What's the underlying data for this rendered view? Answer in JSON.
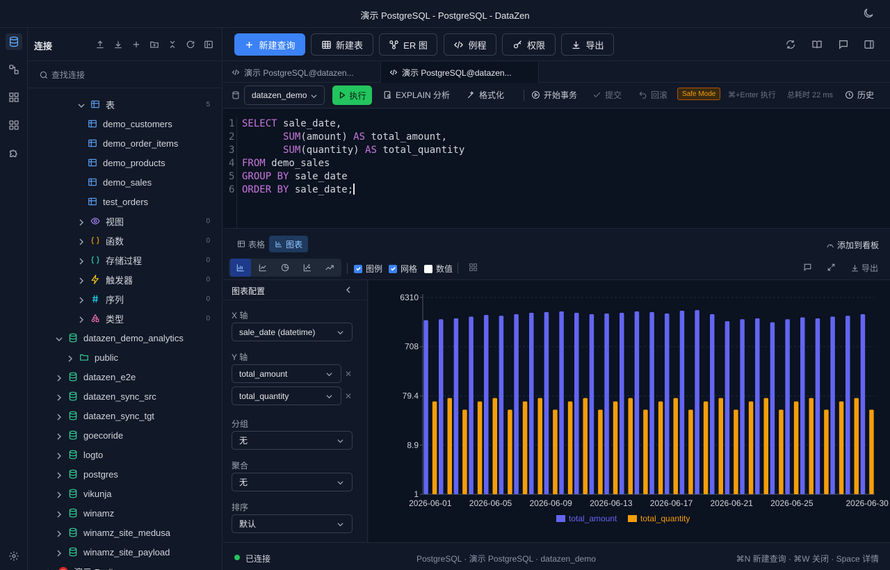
{
  "window": {
    "title": "演示 PostgreSQL - PostgreSQL - DataZen"
  },
  "sidebar": {
    "title": "连接",
    "search_placeholder": "查找连接",
    "tree": [
      {
        "label": "表",
        "count": "5",
        "indent": 1,
        "icon": "table-icon",
        "chev": "down"
      },
      {
        "label": "demo_customers",
        "indent": 2,
        "icon": "table-icon"
      },
      {
        "label": "demo_order_items",
        "indent": 2,
        "icon": "table-icon"
      },
      {
        "label": "demo_products",
        "indent": 2,
        "icon": "table-icon"
      },
      {
        "label": "demo_sales",
        "indent": 2,
        "icon": "table-icon"
      },
      {
        "label": "test_orders",
        "indent": 2,
        "icon": "table-icon"
      },
      {
        "label": "视图",
        "count": "0",
        "indent": 1,
        "icon": "eye-icon",
        "chev": "right"
      },
      {
        "label": "函数",
        "count": "0",
        "indent": 1,
        "icon": "braces-icon",
        "chev": "right"
      },
      {
        "label": "存储过程",
        "count": "0",
        "indent": 1,
        "icon": "braces-teal-icon",
        "chev": "right"
      },
      {
        "label": "触发器",
        "count": "0",
        "indent": 1,
        "icon": "bolt-icon",
        "chev": "right"
      },
      {
        "label": "序列",
        "count": "0",
        "indent": 1,
        "icon": "hash-icon",
        "chev": "right"
      },
      {
        "label": "类型",
        "count": "0",
        "indent": 1,
        "icon": "shapes-icon",
        "chev": "right"
      },
      {
        "label": "datazen_demo_analytics",
        "indent": 0,
        "icon": "database-icon",
        "chev": "down"
      },
      {
        "label": "public",
        "indent": 0.5,
        "icon": "folder-icon",
        "chev": "right"
      },
      {
        "label": "datazen_e2e",
        "indent": 0,
        "icon": "database-icon",
        "chev": "right"
      },
      {
        "label": "datazen_sync_src",
        "indent": 0,
        "icon": "database-icon",
        "chev": "right"
      },
      {
        "label": "datazen_sync_tgt",
        "indent": 0,
        "icon": "database-icon",
        "chev": "right"
      },
      {
        "label": "goecoride",
        "indent": 0,
        "icon": "database-icon",
        "chev": "right"
      },
      {
        "label": "logto",
        "indent": 0,
        "icon": "database-icon",
        "chev": "right"
      },
      {
        "label": "postgres",
        "indent": 0,
        "icon": "database-icon",
        "chev": "right"
      },
      {
        "label": "vikunja",
        "indent": 0,
        "icon": "database-icon",
        "chev": "right"
      },
      {
        "label": "winamz",
        "indent": 0,
        "icon": "database-icon",
        "chev": "right"
      },
      {
        "label": "winamz_site_medusa",
        "indent": 0,
        "icon": "database-icon",
        "chev": "right"
      },
      {
        "label": "winamz_site_payload",
        "indent": 0,
        "icon": "database-icon",
        "chev": "right"
      },
      {
        "label": "演示 Redis",
        "indent": -1,
        "icon": "redis-icon",
        "chev": "right"
      }
    ]
  },
  "toolbar": {
    "new_query": "新建查询",
    "new_table": "新建表",
    "er": "ER 图",
    "routine": "例程",
    "perm": "权限",
    "export": "导出"
  },
  "tabs": [
    {
      "label": "演示 PostgreSQL@datazen..."
    },
    {
      "label": "演示 PostgreSQL@datazen..."
    }
  ],
  "editor_toolbar": {
    "db": "datazen_demo",
    "run": "执行",
    "explain": "EXPLAIN 分析",
    "format": "格式化",
    "begin_tx": "开始事务",
    "commit": "提交",
    "rollback": "回滚",
    "safe_mode": "Safe Mode",
    "shortcut": "⌘+Enter 执行",
    "elapsed": "总耗时 22 ms",
    "history": "历史"
  },
  "editor": {
    "line_numbers": [
      "1",
      "2",
      "3",
      "4",
      "5",
      "6"
    ]
  },
  "results": {
    "tab_table": "表格",
    "tab_chart": "图表",
    "add_board": "添加到看板",
    "legend_label": "图例",
    "grid_label": "网格",
    "values_label": "数值",
    "export": "导出"
  },
  "config": {
    "title": "图表配置",
    "x_label": "X 轴",
    "x_value": "sale_date (datetime)",
    "y_label": "Y 轴",
    "y_values": [
      "total_amount",
      "total_quantity"
    ],
    "group_label": "分组",
    "group_value": "无",
    "agg_label": "聚合",
    "agg_value": "无",
    "sort_label": "排序",
    "sort_value": "默认"
  },
  "chart_data": {
    "type": "bar",
    "scale": "log",
    "grid": true,
    "legend": "bottom",
    "y_ticks": [
      "6310",
      "708",
      "79.4",
      "8.9",
      "1"
    ],
    "ylim": [
      1,
      6310
    ],
    "x_tick_labels": [
      "2026-06-01",
      "2026-06-05",
      "2026-06-09",
      "2026-06-13",
      "2026-06-17",
      "2026-06-21",
      "2026-06-25",
      "2026-06-30"
    ],
    "categories": [
      "2026-06-01",
      "2026-06-02",
      "2026-06-03",
      "2026-06-04",
      "2026-06-05",
      "2026-06-06",
      "2026-06-07",
      "2026-06-08",
      "2026-06-09",
      "2026-06-10",
      "2026-06-11",
      "2026-06-12",
      "2026-06-13",
      "2026-06-14",
      "2026-06-15",
      "2026-06-16",
      "2026-06-17",
      "2026-06-18",
      "2026-06-19",
      "2026-06-20",
      "2026-06-21",
      "2026-06-22",
      "2026-06-23",
      "2026-06-24",
      "2026-06-25",
      "2026-06-26",
      "2026-06-27",
      "2026-06-28",
      "2026-06-29",
      "2026-06-30"
    ],
    "series": [
      {
        "name": "total_amount",
        "color": "#6366f1",
        "values": [
          2300,
          2400,
          2500,
          2700,
          2900,
          2800,
          3000,
          3200,
          3300,
          3400,
          3200,
          3000,
          3100,
          3200,
          3400,
          3300,
          3100,
          3500,
          3600,
          3000,
          2200,
          2400,
          2500,
          2100,
          2400,
          2600,
          2500,
          2700,
          2800,
          3000
        ]
      },
      {
        "name": "total_quantity",
        "color": "#f59e0b",
        "values": [
          62,
          72,
          43,
          62,
          72,
          43,
          62,
          72,
          43,
          62,
          72,
          43,
          62,
          72,
          43,
          62,
          72,
          43,
          62,
          72,
          43,
          62,
          72,
          43,
          62,
          72,
          43,
          62,
          72,
          43
        ]
      }
    ]
  },
  "status": {
    "connected": "已连接",
    "info": "PostgreSQL · 演示 PostgreSQL · datazen_demo",
    "shortcuts": "⌘N 新建查询 · ⌘W 关闭 · Space 详情"
  }
}
